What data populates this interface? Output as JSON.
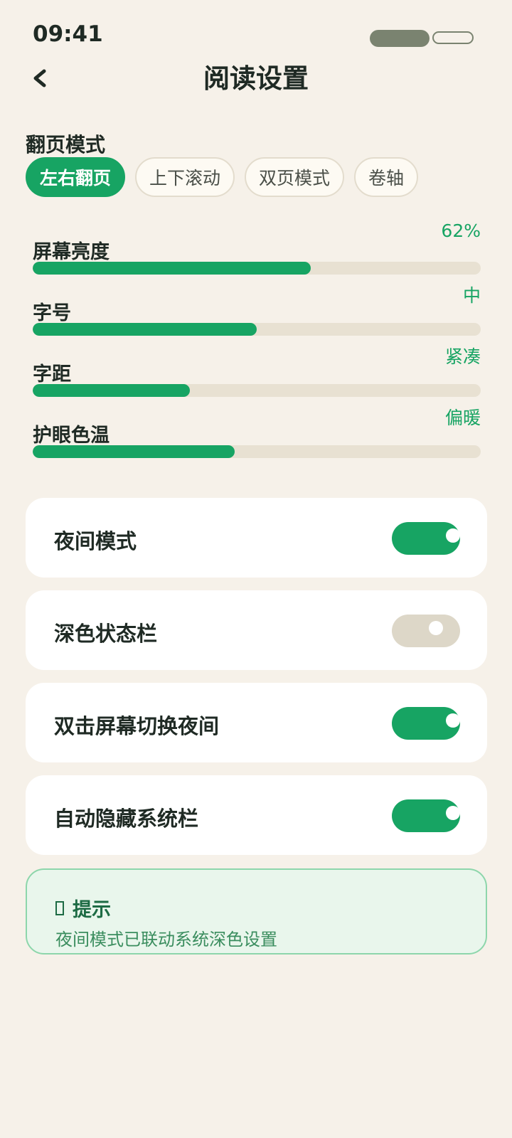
{
  "status": {
    "time": "09:41"
  },
  "header": {
    "title": "阅读设置"
  },
  "page_mode": {
    "label": "翻页模式",
    "options": [
      "左右翻页",
      "上下滚动",
      "双页模式",
      "卷轴"
    ],
    "selected": "左右翻页"
  },
  "sliders": [
    {
      "label": "屏幕亮度",
      "value": "62%",
      "level": 0.62
    },
    {
      "label": "字号",
      "value": "中",
      "level": 0.5
    },
    {
      "label": "字距",
      "value": "紧凑",
      "level": 0.35
    },
    {
      "label": "护眼色温",
      "value": "偏暖",
      "level": 0.45
    }
  ],
  "toggles": [
    {
      "label": "夜间模式",
      "on": true
    },
    {
      "label": "深色状态栏",
      "on": false
    },
    {
      "label": "双击屏幕切换夜间",
      "on": true
    },
    {
      "label": "自动隐藏系统栏",
      "on": true
    }
  ],
  "tip": {
    "title": "提示",
    "text": "夜间模式已联动系统深色设置"
  },
  "colors": {
    "accent": "#17a463",
    "background": "#f6f1e9",
    "track": "#e8e1d2"
  }
}
